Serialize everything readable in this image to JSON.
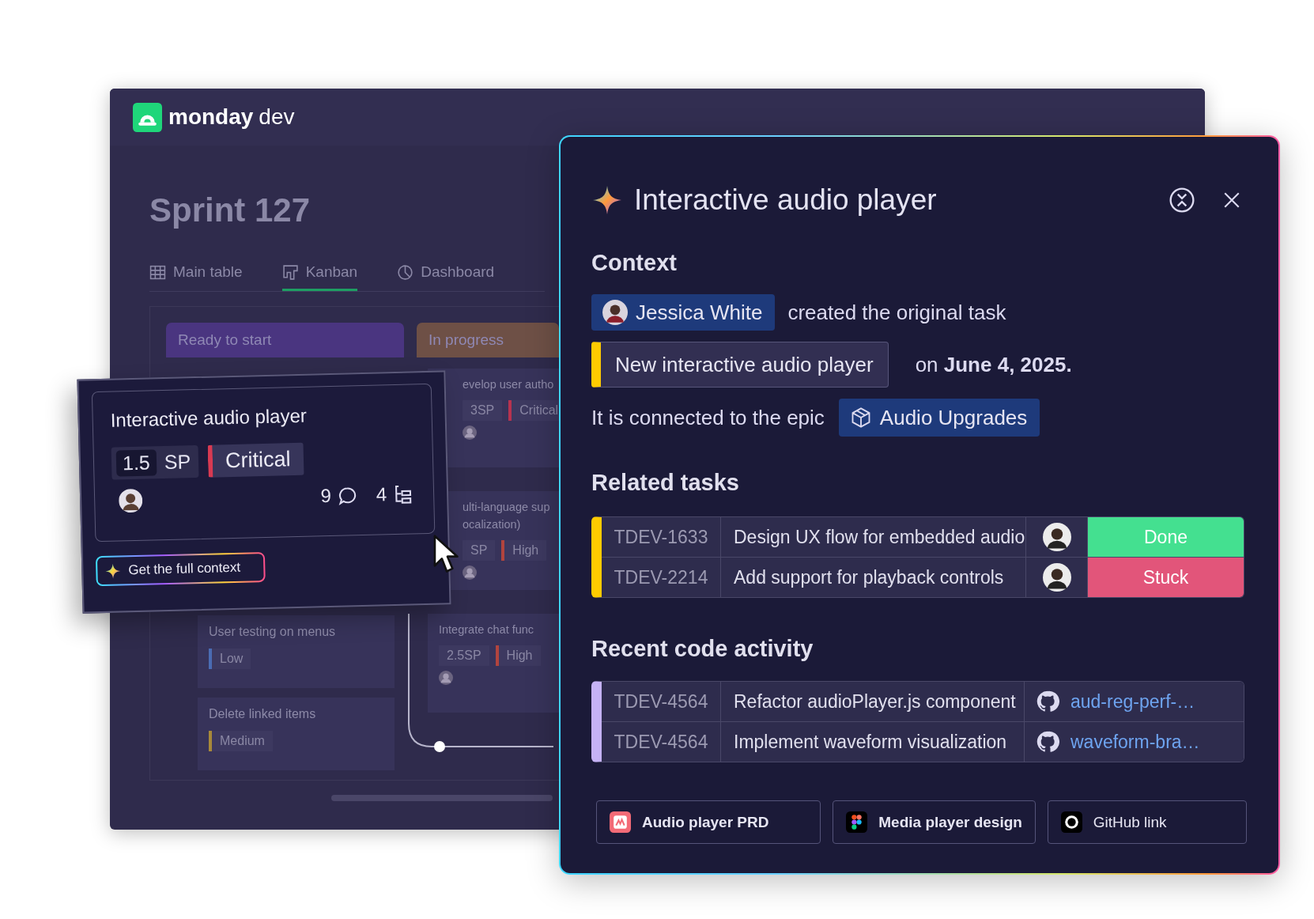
{
  "brand": {
    "name": "monday",
    "product": "dev"
  },
  "board": {
    "title": "Sprint 127",
    "tabs": [
      {
        "label": "Main table",
        "selected": false
      },
      {
        "label": "Kanban",
        "selected": true
      },
      {
        "label": "Dashboard",
        "selected": false
      }
    ],
    "columns": [
      {
        "title": "Ready to start",
        "color": "#4a3580",
        "cards": [
          {
            "lines": [
              "User testing on menus"
            ],
            "tag": {
              "label": "Low",
              "color": "#4a6cb3"
            }
          },
          {
            "lines": [
              "Delete linked items"
            ],
            "tag": {
              "label": "Medium",
              "color": "#a8893a"
            }
          }
        ]
      },
      {
        "title": "In progress",
        "color": "#6e5046",
        "cards": [
          {
            "lines": [
              "evelop user autho"
            ],
            "points": "3",
            "unit": "SP",
            "tag": {
              "label": "Critical",
              "color": "#b8334f"
            }
          },
          {
            "lines": [
              "ulti-language sup",
              "ocalization)"
            ],
            "unit": "SP",
            "tag": {
              "label": "High",
              "color": "#b2443e"
            }
          },
          {
            "lines": [
              "Integrate chat func"
            ],
            "points": "2.5",
            "unit": "SP",
            "tag": {
              "label": "High",
              "color": "#b2443e"
            }
          }
        ]
      }
    ]
  },
  "card": {
    "title": "Interactive audio player",
    "points": "1.5",
    "unit": "SP",
    "priority": {
      "label": "Critical",
      "color": "#d83a52"
    },
    "comments": "9",
    "subitems": "4",
    "button": "Get the full context"
  },
  "panel": {
    "title": "Interactive audio player",
    "context": {
      "heading": "Context",
      "creator": "Jessica White",
      "created_text": "created the original task",
      "original_task": "New interactive audio player",
      "date_text": "on **June 4, 2025.**",
      "epic_text": "It is connected to the epic",
      "epic": "Audio Upgrades"
    },
    "related": {
      "heading": "Related tasks",
      "color": "#ffcb00",
      "rows": [
        {
          "id": "TDEV-1633",
          "title": "Design UX flow for embedded audio",
          "status": {
            "label": "Done",
            "color": "#44e090"
          }
        },
        {
          "id": "TDEV-2214",
          "title": "Add support for playback controls",
          "status": {
            "label": "Stuck",
            "color": "#e2557a"
          }
        }
      ]
    },
    "code": {
      "heading": "Recent code activity",
      "color": "#c5b2f5",
      "rows": [
        {
          "id": "TDEV-4564",
          "title": "Refactor audioPlayer.js component",
          "branch": "aud-reg-perf-…"
        },
        {
          "id": "TDEV-4564",
          "title": "Implement waveform visualization",
          "branch": "waveform-bra…"
        }
      ]
    },
    "links": [
      {
        "label": "Audio player PRD"
      },
      {
        "label": "Media player design"
      },
      {
        "label": "GitHub link"
      }
    ]
  }
}
